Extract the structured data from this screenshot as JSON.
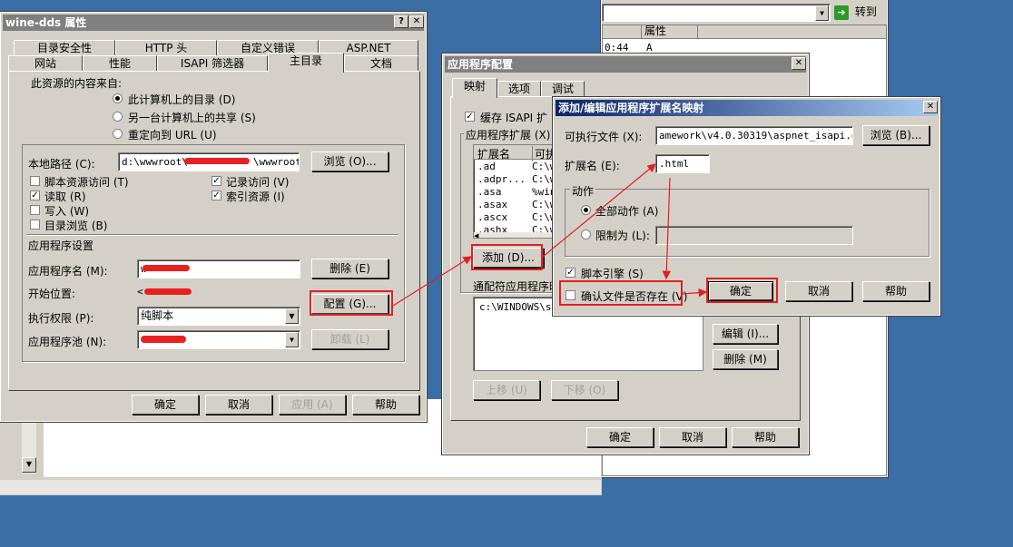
{
  "bg": {
    "explorer_go_label": "转到",
    "col_attr": "属性",
    "file_time": "0:44",
    "file_attr": "A"
  },
  "props": {
    "title": "wine-dds 属性",
    "tabs_row1": [
      "目录安全性",
      "HTTP 头",
      "自定义错误",
      "ASP.NET"
    ],
    "tabs_row2": [
      "网站",
      "性能",
      "ISAPI 筛选器",
      "主目录",
      "文档"
    ],
    "source_label": "此资源的内容来自:",
    "source_options": [
      "此计算机上的目录 (D)",
      "另一台计算机上的共享 (S)",
      "重定向到 URL (U)"
    ],
    "local_path_label": "本地路径 (C):",
    "local_path_value": "d:\\wwwroot\\",
    "local_path_tail": "\\wwwroot",
    "browse_label": "浏览 (O)...",
    "checks_left": [
      "脚本资源访问 (T)",
      "读取 (R)",
      "写入 (W)",
      "目录浏览 (B)"
    ],
    "checks_right": [
      "记录访问 (V)",
      "索引资源 (I)"
    ],
    "app_settings_label": "应用程序设置",
    "app_name_label": "应用程序名 (M):",
    "app_name_value": "w",
    "remove_label": "删除 (E)",
    "start_label": "开始位置:",
    "start_value": "<",
    "config_label": "配置 (G)...",
    "perm_label": "执行权限 (P):",
    "perm_value": "纯脚本",
    "pool_label": "应用程序池 (N):",
    "unload_label": "卸载 (L)",
    "ok": "确定",
    "cancel": "取消",
    "apply": "应用 (A)",
    "help": "帮助"
  },
  "appcfg": {
    "title": "应用程序配置",
    "tabs": [
      "映射",
      "选项",
      "调试"
    ],
    "cache_label": "缓存 ISAPI 扩",
    "ext_group_label": "应用程序扩展 (X)",
    "col_ext": "扩展名",
    "col_exe": "可执",
    "rows": [
      {
        "ext": ".ad",
        "exe": "C:\\w"
      },
      {
        "ext": ".adpr...",
        "exe": "C:\\w"
      },
      {
        "ext": ".asa",
        "exe": "%win"
      },
      {
        "ext": ".asax",
        "exe": "C:\\w"
      },
      {
        "ext": ".ascx",
        "exe": "C:\\w"
      },
      {
        "ext": ".ashx",
        "exe": "C:\\w"
      }
    ],
    "add_label": "添加 (D)...",
    "wildcard_label": "通配符应用程序映",
    "wildcard_value": "c:\\WINDOWS\\sys",
    "edit_label": "编辑 (I)...",
    "delete_label": "删除 (M)",
    "up_label": "上移 (U)",
    "down_label": "下移 (O)",
    "ok": "确定",
    "cancel": "取消",
    "help": "帮助"
  },
  "addmap": {
    "title": "添加/编辑应用程序扩展名映射",
    "exe_label": "可执行文件 (X):",
    "exe_value": "amework\\v4.0.30319\\aspnet_isapi.dll",
    "browse_label": "浏览 (B)...",
    "ext_label": "扩展名 (E):",
    "ext_value": ".html",
    "action_label": "动作",
    "all_verbs": "全部动作 (A)",
    "limit_to": "限制为 (L):",
    "script_engine": "脚本引擎 (S)",
    "verify_file": "确认文件是否存在 (V)",
    "ok": "确定",
    "cancel": "取消",
    "help": "帮助"
  },
  "colors": {
    "highlight": "#e02020",
    "title_active": "#0a246a",
    "face": "#d4d0c8",
    "desktop": "#3a6ea5"
  }
}
